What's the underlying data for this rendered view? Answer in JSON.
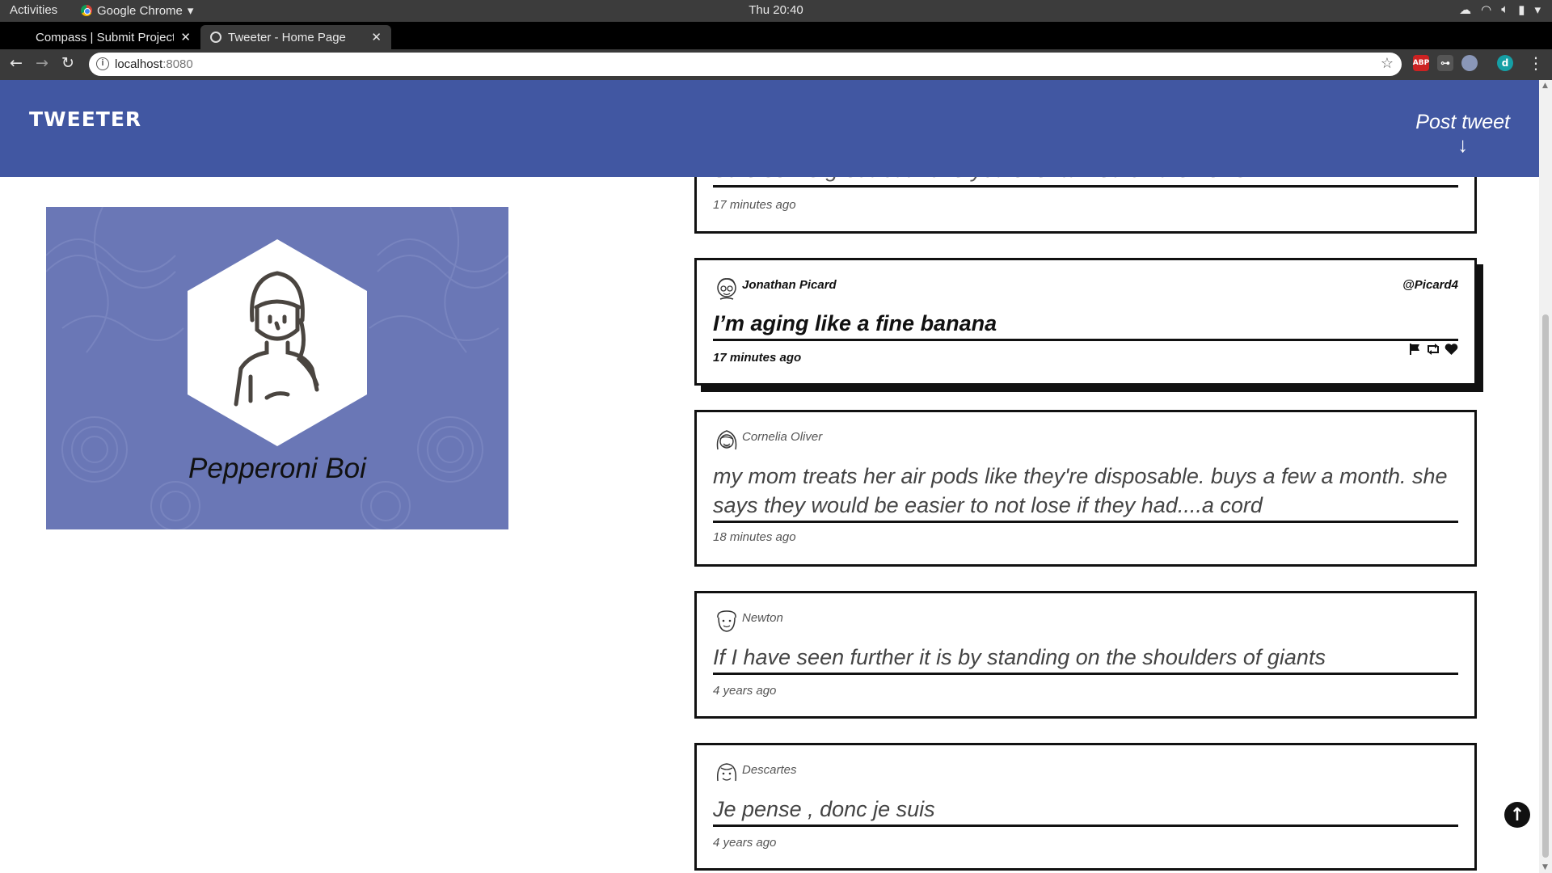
{
  "system_bar": {
    "activities": "Activities",
    "app_name": "Google Chrome",
    "clock": "Thu 20:40"
  },
  "browser": {
    "tabs": [
      {
        "title": "Compass | Submit Project",
        "active": false
      },
      {
        "title": "Tweeter - Home Page",
        "active": true
      }
    ],
    "url_host": "localhost",
    "url_port": ":8080",
    "profile_initial": "d",
    "abp_label": "ABP"
  },
  "site": {
    "brand": "TWEETER",
    "post_tweet_label": "Post tweet"
  },
  "profile": {
    "name": "Pepperoni Boi"
  },
  "tweets": [
    {
      "name": "",
      "handle": "",
      "text": "Safe sex is great but have you ever turned on the news?",
      "time": "17 minutes ago"
    },
    {
      "name": "Jonathan Picard",
      "handle": "@Picard4",
      "text": "I’m aging like a fine banana",
      "time": "17 minutes ago"
    },
    {
      "name": "Cornelia Oliver",
      "handle": "",
      "text": "my mom treats her air pods like they're disposable. buys a few a month. she says they would be easier to not lose if they had....a cord",
      "time": "18 minutes ago"
    },
    {
      "name": "Newton",
      "handle": "",
      "text": "If I have seen further it is by standing on the shoulders of giants",
      "time": "4 years ago"
    },
    {
      "name": "Descartes",
      "handle": "",
      "text": "Je pense , donc je suis",
      "time": "4 years ago"
    }
  ],
  "colors": {
    "header_bg": "#4157a2",
    "card_bg": "#6a77b6",
    "border": "#111111"
  }
}
